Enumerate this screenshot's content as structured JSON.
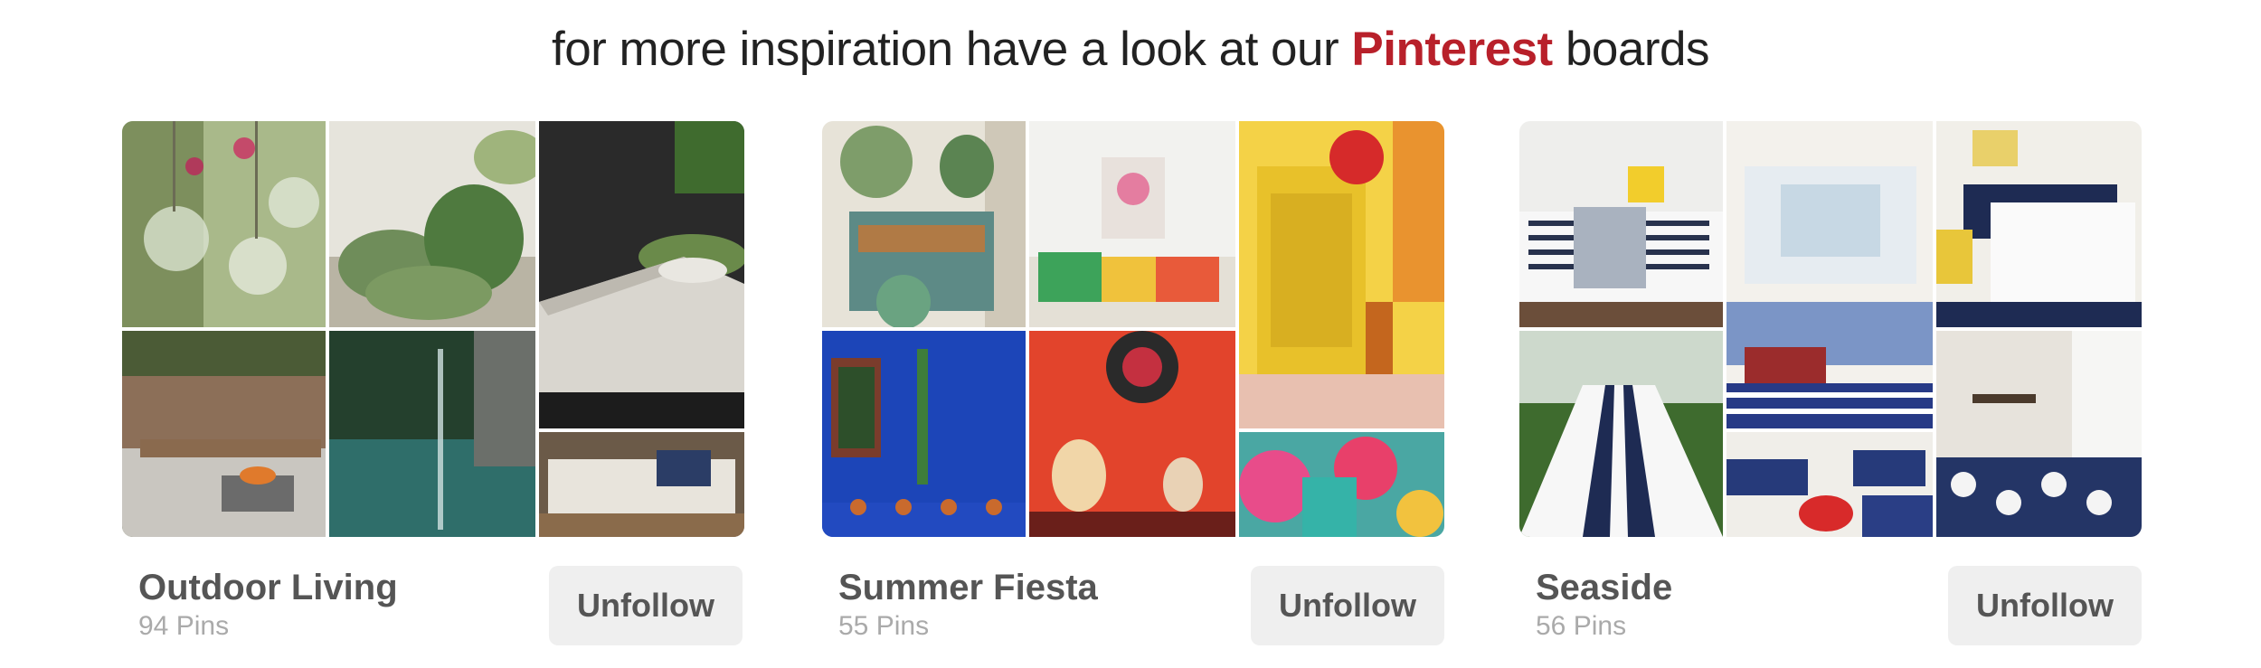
{
  "heading": {
    "prefix": "for more inspiration have a look at our",
    "brand": "Pinterest",
    "suffix": "boards"
  },
  "colors": {
    "brand": "#b8202a",
    "button_bg": "#efefef",
    "title": "#555555",
    "count": "#aaaaaa"
  },
  "boards": [
    {
      "title": "Outdoor Living",
      "count": "94 Pins",
      "button": "Unfollow"
    },
    {
      "title": "Summer Fiesta",
      "count": "55 Pins",
      "button": "Unfollow"
    },
    {
      "title": "Seaside",
      "count": "56 Pins",
      "button": "Unfollow"
    }
  ]
}
